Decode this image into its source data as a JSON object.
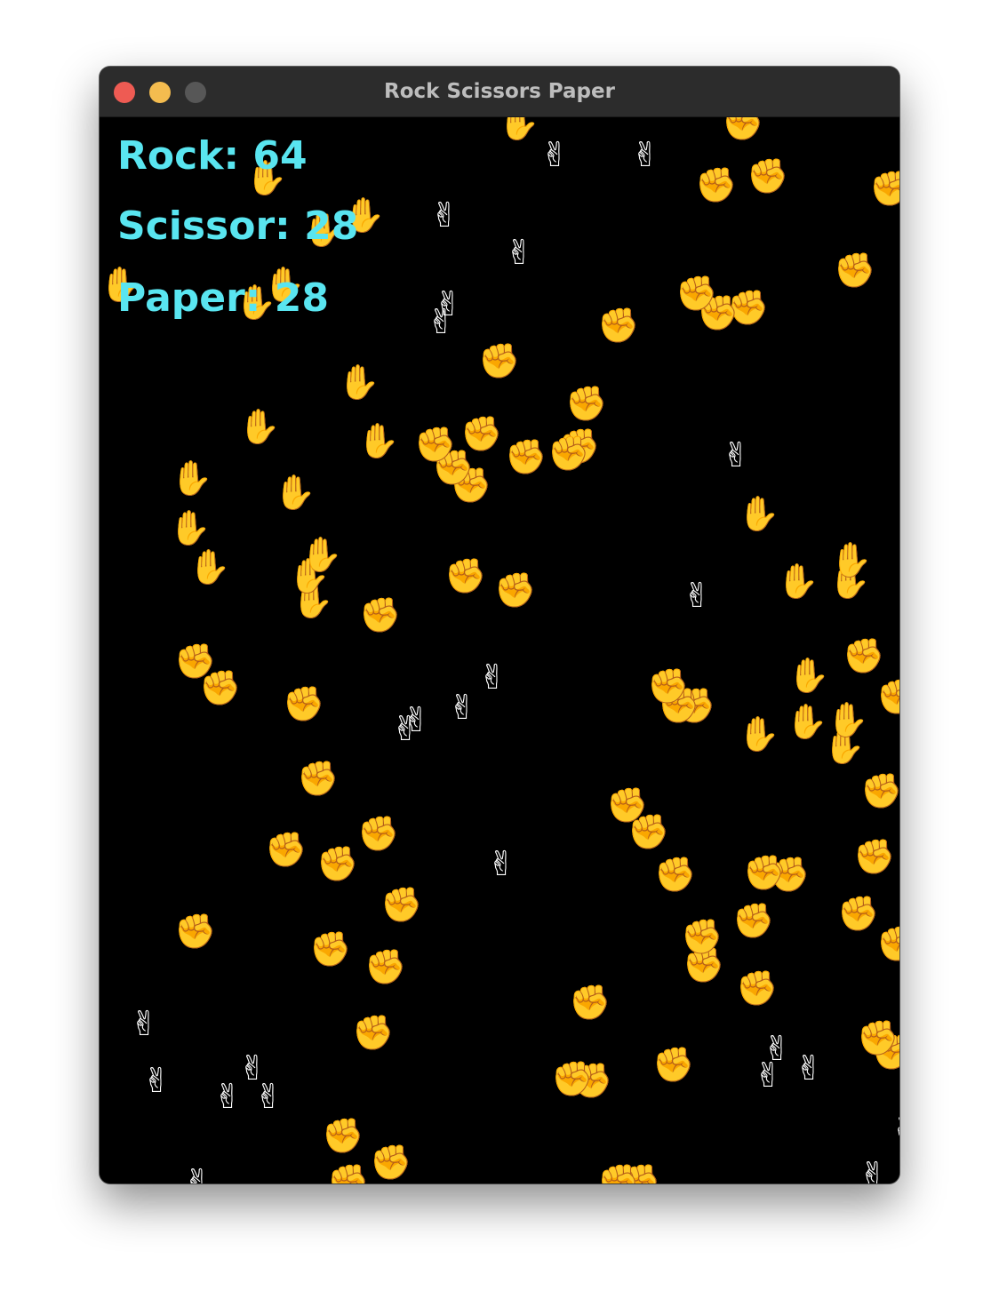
{
  "window": {
    "title": "Rock Scissors Paper"
  },
  "scores": {
    "rock": "Rock: 64",
    "scissor": "Scissor: 28",
    "paper": "Paper: 28"
  },
  "colors": {
    "score_text": "#59e5f0",
    "background": "#000000",
    "sprite": "#ffffff"
  },
  "icons": {
    "rock": "raised-fist-icon",
    "paper": "raised-hand-icon",
    "scissors": "victory-hand-icon"
  }
}
